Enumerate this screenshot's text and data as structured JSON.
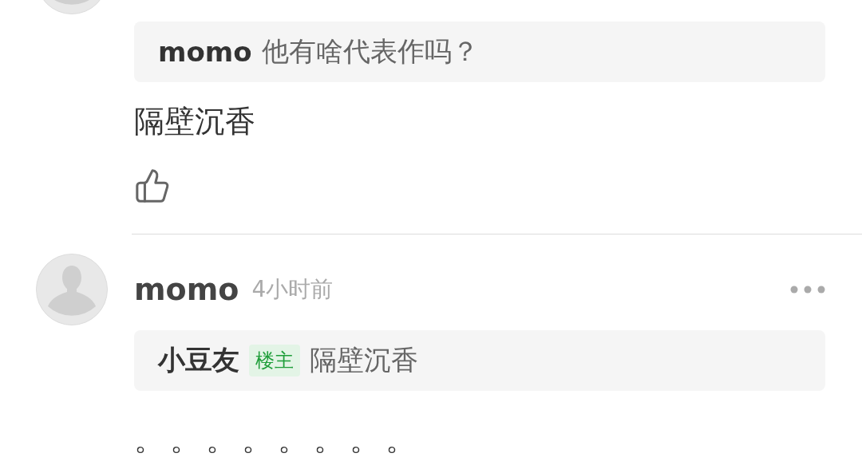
{
  "comments": [
    {
      "kind": "continued",
      "reply_to": {
        "name": "momo",
        "text": "他有啥代表作吗？"
      },
      "text": "隔壁沉香"
    },
    {
      "kind": "full",
      "author": "momo",
      "time": "4小时前",
      "reply_to": {
        "name": "小豆友",
        "badge": "楼主",
        "text": "隔壁沉香"
      },
      "text": "。。。。。。。。"
    }
  ]
}
